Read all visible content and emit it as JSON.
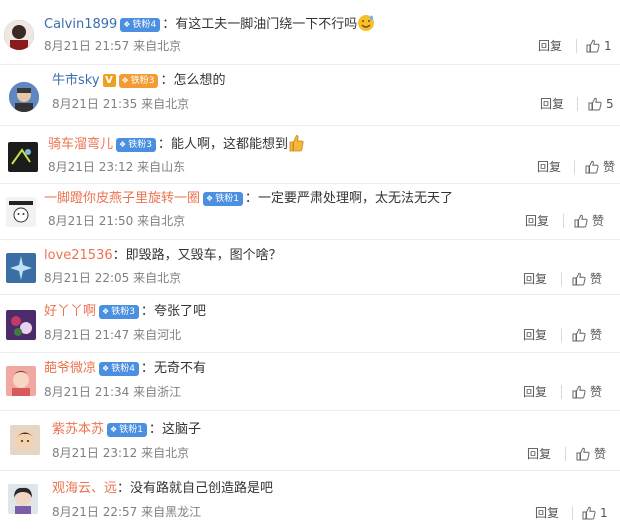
{
  "comments": [
    {
      "user": "Calvin1899",
      "user_color": "blue",
      "badge": "铁粉4",
      "badge_color": "blue",
      "vip": false,
      "text": "有这工夫一脚油门绕一下不行吗",
      "emoji": "sweat-smile-emoji",
      "time": "8月21日 21:57 来自北京",
      "reply": "回复",
      "likes": "1"
    },
    {
      "user": "牛市sky",
      "user_color": "blue",
      "badge": "铁粉3",
      "badge_color": "orange",
      "vip": true,
      "vip_label": "V",
      "text": "怎么想的",
      "emoji": null,
      "time": "8月21日 21:35 来自北京",
      "reply": "回复",
      "likes": "5"
    },
    {
      "user": "骑车溜弯儿",
      "user_color": "orange",
      "badge": "铁粉3",
      "badge_color": "blue",
      "vip": false,
      "text": "能人啊，这都能想到",
      "emoji": "thumbs-up-emoji",
      "time": "8月21日 23:12 来自山东",
      "reply": "回复",
      "likes": "赞"
    },
    {
      "user": "一脚蹬你皮燕子里旋转一圈",
      "user_color": "orange",
      "badge": "铁粉1",
      "badge_color": "blue",
      "vip": false,
      "text": "一定要严肃处理啊，太无法无天了",
      "emoji": null,
      "time": "8月21日 21:50 来自北京",
      "reply": "回复",
      "likes": "赞"
    },
    {
      "user": "love21536",
      "user_color": "orange",
      "badge": null,
      "badge_color": "blue",
      "vip": false,
      "text": "即毁路，又毁车，图个啥？",
      "emoji": null,
      "time": "8月21日 22:05 来自北京",
      "reply": "回复",
      "likes": "赞"
    },
    {
      "user": "好丫丫啊",
      "user_color": "orange",
      "badge": "铁粉3",
      "badge_color": "blue",
      "vip": false,
      "text": "夸张了吧",
      "emoji": null,
      "time": "8月21日 21:47 来自河北",
      "reply": "回复",
      "likes": "赞"
    },
    {
      "user": "葩爷微凉",
      "user_color": "orange",
      "badge": "铁粉4",
      "badge_color": "blue",
      "vip": false,
      "text": "无奇不有",
      "emoji": null,
      "time": "8月21日 21:34 来自浙江",
      "reply": "回复",
      "likes": "赞"
    },
    {
      "user": "紫苏本苏",
      "user_color": "orange",
      "badge": "铁粉1",
      "badge_color": "blue",
      "vip": false,
      "text": "这脑子",
      "emoji": null,
      "time": "8月21日 23:12 来自北京",
      "reply": "回复",
      "likes": "赞"
    },
    {
      "user": "观海云、远",
      "user_color": "orange",
      "badge": null,
      "badge_color": "blue",
      "vip": false,
      "text": "没有路就自己创造路是吧",
      "emoji": null,
      "time": "8月21日 22:57 来自黑龙江",
      "reply": "回复",
      "likes": "1"
    }
  ],
  "colors": {
    "username_orange": "#eb7350",
    "username_blue": "#3e6cb0",
    "meta_gray": "#808080",
    "badge_blue": "#4a8fe0",
    "badge_orange": "#f39c34"
  }
}
